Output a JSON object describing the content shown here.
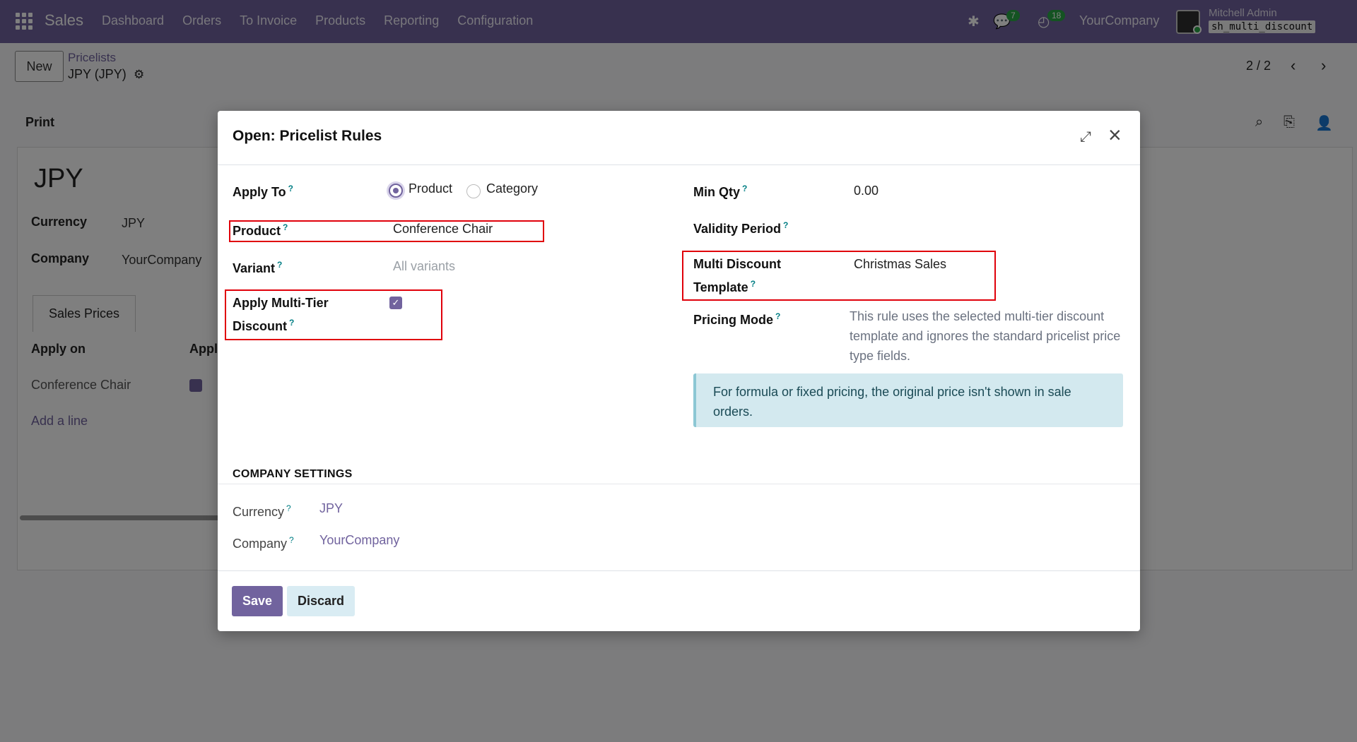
{
  "navbar": {
    "brand": "Sales",
    "menu": [
      "Dashboard",
      "Orders",
      "To Invoice",
      "Products",
      "Reporting",
      "Configuration"
    ],
    "chat_badge": "7",
    "activity_badge": "18",
    "company": "YourCompany",
    "user": "Mitchell Admin",
    "database": "sh_multi_discount"
  },
  "control": {
    "new_label": "New",
    "breadcrumb_parent": "Pricelists",
    "breadcrumb_current": "JPY (JPY)",
    "pager": "2 / 2"
  },
  "background_form": {
    "print_label": "Print",
    "title": "JPY",
    "currency_label": "Currency",
    "currency_value": "JPY",
    "company_label": "Company",
    "company_value": "YourCompany",
    "tab_label": "Sales Prices",
    "col_apply_on": "Apply on",
    "col_apply_cut": "Appl",
    "row_product": "Conference Chair",
    "add_line": "Add a line"
  },
  "modal": {
    "title": "Open: Pricelist Rules",
    "apply_to_label": "Apply To",
    "apply_to_options": [
      "Product",
      "Category"
    ],
    "apply_to_selected": "Product",
    "product_label": "Product",
    "product_value": "Conference Chair",
    "variant_label": "Variant",
    "variant_placeholder": "All variants",
    "multi_tier_label": "Apply Multi-Tier Discount",
    "multi_tier_label_line1": "Apply Multi-Tier",
    "multi_tier_label_line2": "Discount",
    "multi_tier_checked": true,
    "min_qty_label": "Min Qty",
    "min_qty_value": "0.00",
    "validity_label": "Validity Period",
    "template_label_line1": "Multi Discount",
    "template_label_line2": "Template",
    "template_value": "Christmas Sales",
    "pricing_mode_label": "Pricing Mode",
    "pricing_mode_desc": "This rule uses the selected multi-tier discount template and ignores the standard pricelist price type fields.",
    "alert_text": "For formula or fixed pricing, the original price isn't shown in sale orders.",
    "company_section_title": "COMPANY SETTINGS",
    "company_currency_label": "Currency",
    "company_currency_value": "JPY",
    "company_company_label": "Company",
    "company_company_value": "YourCompany",
    "save_label": "Save",
    "discard_label": "Discard",
    "help_marker": "?"
  },
  "colors": {
    "brand": "#71639e",
    "highlight": "#e0000a",
    "alert_bg": "#d3e9ef"
  }
}
